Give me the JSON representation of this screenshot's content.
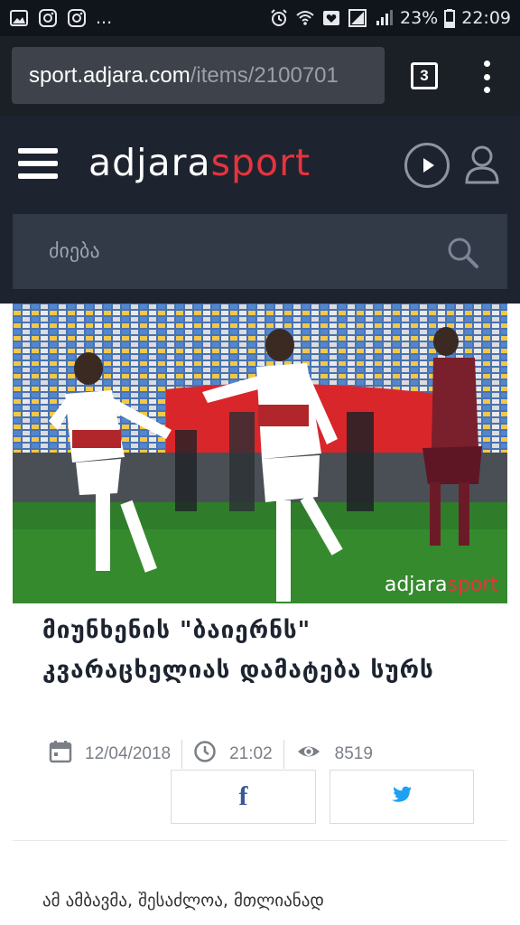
{
  "status_bar": {
    "left_icons": [
      "image-icon",
      "instagram-icon",
      "instagram-icon"
    ],
    "more": "...",
    "right_icons": [
      "alarm-icon",
      "wifi-icon",
      "heart-box-icon",
      "signal-icon",
      "signal-icon",
      "battery-icon"
    ],
    "battery_percent": "23%",
    "time": "22:09"
  },
  "browser": {
    "url_host": "sport.adjara.com",
    "url_path": "/items/2100701",
    "tab_count": "3",
    "menu_icon": "kebab-menu-icon"
  },
  "site_header": {
    "logo_part1": "adjara",
    "logo_part2": "sport",
    "search_placeholder": "ძიება",
    "colors": {
      "brand_red": "#e8333e",
      "header_bg": "#1d2430",
      "search_bg": "#323a48"
    }
  },
  "hero": {
    "watermark_part1": "adjara",
    "watermark_part2": "sport"
  },
  "article": {
    "headline": "მიუნხენის \"ბაიერნს\" კვარაცხელიას დამატება სურს",
    "date": "12/04/2018",
    "time": "21:02",
    "views": "8519",
    "share_facebook": "f",
    "share_twitter_icon": "twitter-bird-icon",
    "lead": "ამ ამბავმა, შესაძლოა, მთლიანად"
  }
}
